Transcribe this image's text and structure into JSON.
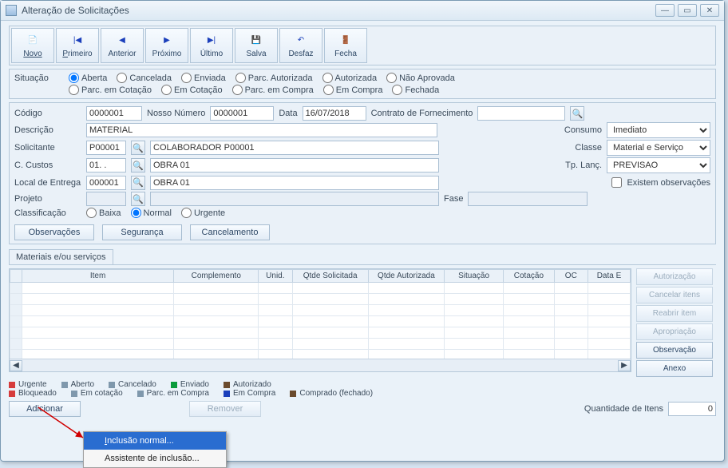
{
  "window": {
    "title": "Alteração de Solicitações"
  },
  "toolbar": {
    "novo": "Novo",
    "primeiro": "Primeiro",
    "anterior": "Anterior",
    "proximo": "Próximo",
    "ultimo": "Último",
    "salva": "Salva",
    "desfaz": "Desfaz",
    "fecha": "Fecha"
  },
  "situacao": {
    "label": "Situação",
    "aberta": "Aberta",
    "cancelada": "Cancelada",
    "enviada": "Enviada",
    "parc_autorizada": "Parc. Autorizada",
    "autorizada": "Autorizada",
    "nao_aprovada": "Não Aprovada",
    "parc_em_cotacao": "Parc. em Cotação",
    "em_cotacao": "Em Cotação",
    "parc_em_compra": "Parc. em Compra",
    "em_compra": "Em Compra",
    "fechada": "Fechada"
  },
  "form": {
    "codigo_label": "Código",
    "codigo_value": "0000001",
    "nosso_numero_label": "Nosso Número",
    "nosso_numero_value": "0000001",
    "data_label": "Data",
    "data_value": "16/07/2018",
    "contrato_label": "Contrato de Fornecimento",
    "contrato_value": "",
    "descricao_label": "Descrição",
    "descricao_value": "MATERIAL",
    "consumo_label": "Consumo",
    "consumo_value": "Imediato",
    "solicitante_label": "Solicitante",
    "solicitante_code": "P00001",
    "solicitante_name": "COLABORADOR P00001",
    "classe_label": "Classe",
    "classe_value": "Material e Serviço",
    "ccustos_label": "C. Custos",
    "ccustos_code": "01. .",
    "ccustos_name": "OBRA 01",
    "tplanc_label": "Tp. Lanç.",
    "tplanc_value": "PREVISAO",
    "local_entrega_label": "Local de Entrega",
    "local_entrega_code": "000001",
    "local_entrega_name": "OBRA 01",
    "existem_obs_label": "Existem observações",
    "projeto_label": "Projeto",
    "projeto_code": "",
    "projeto_name": "",
    "fase_label": "Fase",
    "fase_value": "",
    "classificacao_label": "Classificação",
    "classif_baixa": "Baixa",
    "classif_normal": "Normal",
    "classif_urgente": "Urgente"
  },
  "buttons": {
    "observacoes": "Observações",
    "seguranca": "Segurança",
    "cancelamento": "Cancelamento"
  },
  "tab": {
    "materiais": "Materiais e/ou serviços"
  },
  "grid": {
    "headers": {
      "item": "Item",
      "complemento": "Complemento",
      "unid": "Unid.",
      "qtde_solicitada": "Qtde Solicitada",
      "qtde_autorizada": "Qtde Autorizada",
      "situacao": "Situação",
      "cotacao": "Cotação",
      "oc": "OC",
      "data_e": "Data E"
    }
  },
  "sidebuttons": {
    "autorizacao": "Autorização",
    "cancelar_itens": "Cancelar itens",
    "reabrir_item": "Reabrir item",
    "apropriacao": "Apropriação",
    "observacao": "Observação",
    "anexo": "Anexo"
  },
  "legend": {
    "urgente": "Urgente",
    "bloqueado": "Bloqueado",
    "aberto": "Aberto",
    "em_cotacao": "Em cotação",
    "cancelado": "Cancelado",
    "parc_em_compra": "Parc. em Compra",
    "enviado": "Enviado",
    "em_compra": "Em Compra",
    "autorizado": "Autorizado",
    "comprado_fechado": "Comprado (fechado)",
    "colors": {
      "urgente": "#d63c3c",
      "bloqueado": "#d63c3c",
      "aberto": "#7f98ac",
      "em_cotacao": "#7f98ac",
      "cancelado": "#7f98ac",
      "parc_em_compra": "#7f98ac",
      "enviado": "#0a9b3b",
      "em_compra": "#1b3fbb",
      "autorizado": "#6b4b2d",
      "comprado_fechado": "#6b4b2d"
    }
  },
  "footer": {
    "adicionar": "Adicionar",
    "remover": "Remover",
    "quantidade_label": "Quantidade de Itens",
    "quantidade_value": "0"
  },
  "context_menu": {
    "inclusao_normal": "Inclusão normal...",
    "assistente": "Assistente de inclusão..."
  }
}
